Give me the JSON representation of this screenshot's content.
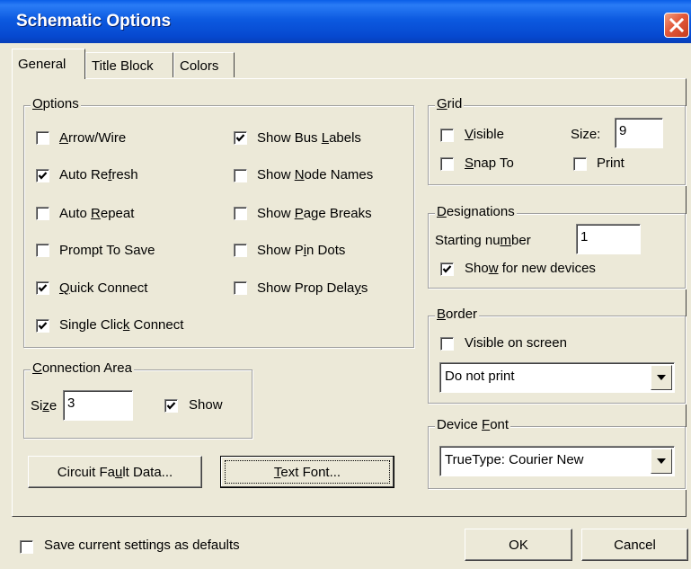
{
  "window": {
    "title": "Schematic Options"
  },
  "tabs": [
    {
      "label": "General",
      "active": true
    },
    {
      "label": "Title Block",
      "active": false
    },
    {
      "label": "Colors",
      "active": false
    }
  ],
  "options": {
    "legend": "Options",
    "items": [
      {
        "label": "Arrow/Wire",
        "checked": false
      },
      {
        "label": "Auto Refresh",
        "checked": true
      },
      {
        "label": "Auto Repeat",
        "checked": false
      },
      {
        "label": "Prompt To Save",
        "checked": false
      },
      {
        "label": "Quick Connect",
        "checked": true
      },
      {
        "label": "Single Click Connect",
        "checked": true
      },
      {
        "label": "Show Bus Labels",
        "checked": true
      },
      {
        "label": "Show Node Names",
        "checked": false
      },
      {
        "label": "Show Page Breaks",
        "checked": false
      },
      {
        "label": "Show Pin Dots",
        "checked": false
      },
      {
        "label": "Show Prop Delays",
        "checked": false
      }
    ]
  },
  "connection_area": {
    "legend": "Connection Area",
    "size_label": "Size",
    "size_value": "3",
    "show_label": "Show",
    "show_checked": true
  },
  "grid": {
    "legend": "Grid",
    "visible_label": "Visible",
    "visible_checked": false,
    "snap_label": "Snap To",
    "snap_checked": false,
    "size_label": "Size:",
    "size_value": "9",
    "print_label": "Print",
    "print_checked": false
  },
  "designations": {
    "legend": "Designations",
    "starting_label": "Starting number",
    "starting_value": "1",
    "show_new_label": "Show for new devices",
    "show_new_checked": true
  },
  "border": {
    "legend": "Border",
    "visible_label": "Visible on screen",
    "visible_checked": false,
    "print_option": "Do not print"
  },
  "device_font": {
    "legend": "Device Font",
    "value": "TrueType: Courier New"
  },
  "buttons": {
    "circuit_fault": "Circuit Fault Data...",
    "text_font": "Text Font...",
    "ok": "OK",
    "cancel": "Cancel"
  },
  "footer": {
    "save_defaults_label": "Save current settings as defaults",
    "save_defaults_checked": false
  },
  "colors": {
    "title_bar": "#0648cf",
    "face": "#ece9d8",
    "close": "#e2583a"
  }
}
